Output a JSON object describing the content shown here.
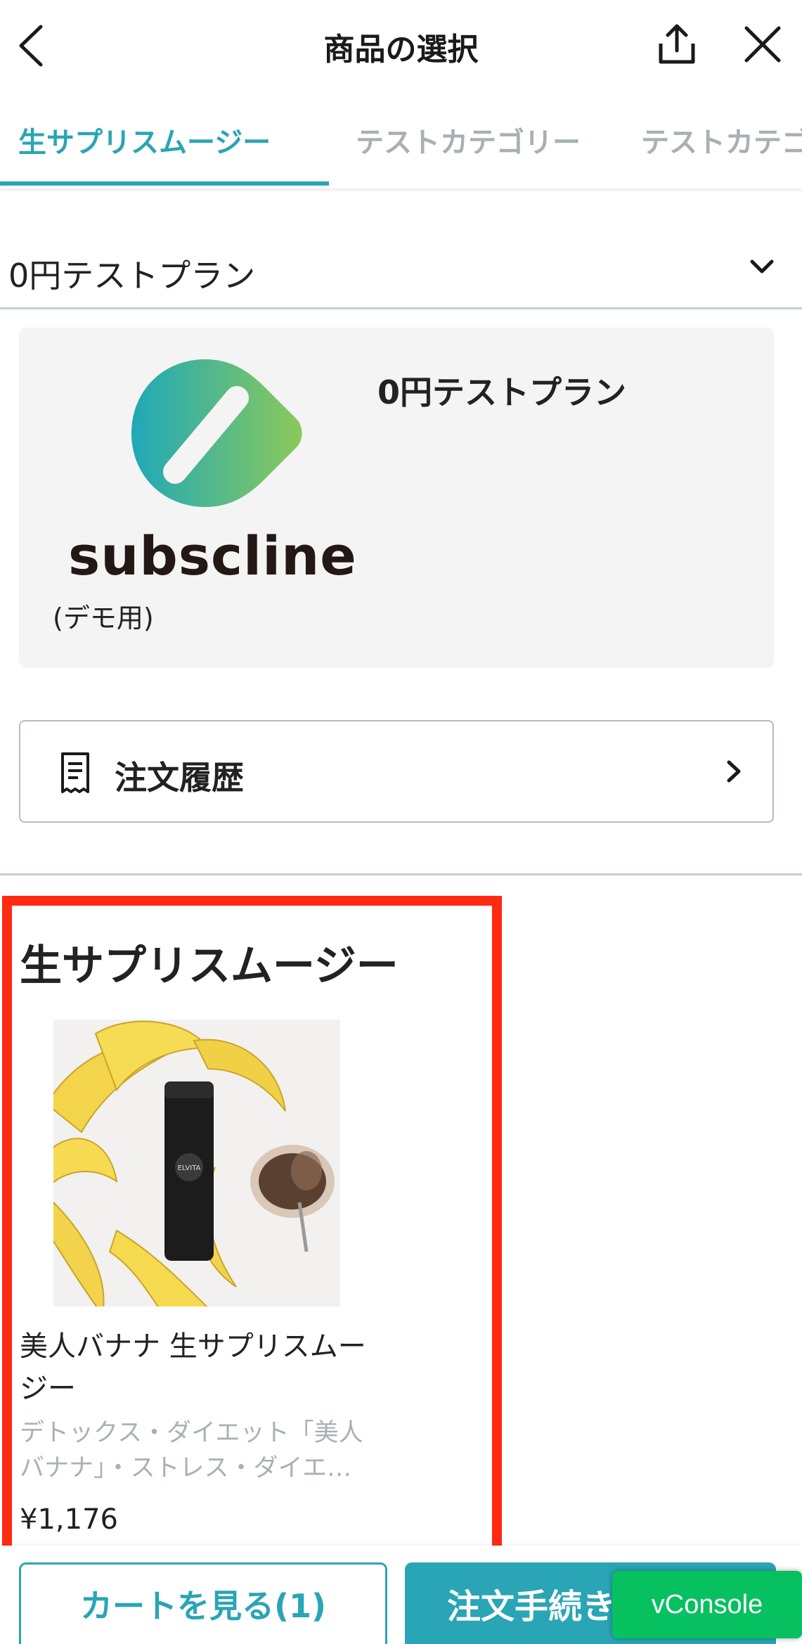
{
  "header": {
    "title": "商品の選択",
    "back_icon": "chevron-left-icon",
    "share_icon": "share-icon",
    "close_icon": "close-icon"
  },
  "tabs": [
    {
      "label": "生サプリスムージー",
      "active": true
    },
    {
      "label": "テストカテゴリー",
      "active": false
    },
    {
      "label": "テストカテゴリー",
      "active": false
    }
  ],
  "plan_select": {
    "value": "0円テストプラン",
    "icon": "chevron-down-icon"
  },
  "plan_card": {
    "brand": "subscline",
    "demo_label": "(デモ用)",
    "plan_name": "0円テストプラン",
    "logo_colors": [
      "#1fa8b8",
      "#8bc95a"
    ]
  },
  "order_history": {
    "label": "注文履歴",
    "icon": "receipt-icon"
  },
  "section": {
    "title": "生サプリスムージー",
    "highlight_color": "#ff2a12"
  },
  "product": {
    "name": "美人バナナ 生サプリスムージー",
    "description": "デトックス・ダイエット「美人バナナ」・ストレス・ダイエ…",
    "price": "¥1,176",
    "bottle_label": "ELVITA"
  },
  "bottom_bar": {
    "cart_label": "カートを見る(1)",
    "checkout_label": "注文手続き",
    "accent_color": "#2aa5b5"
  },
  "vconsole": {
    "label": "vConsole",
    "color": "#07c160"
  }
}
